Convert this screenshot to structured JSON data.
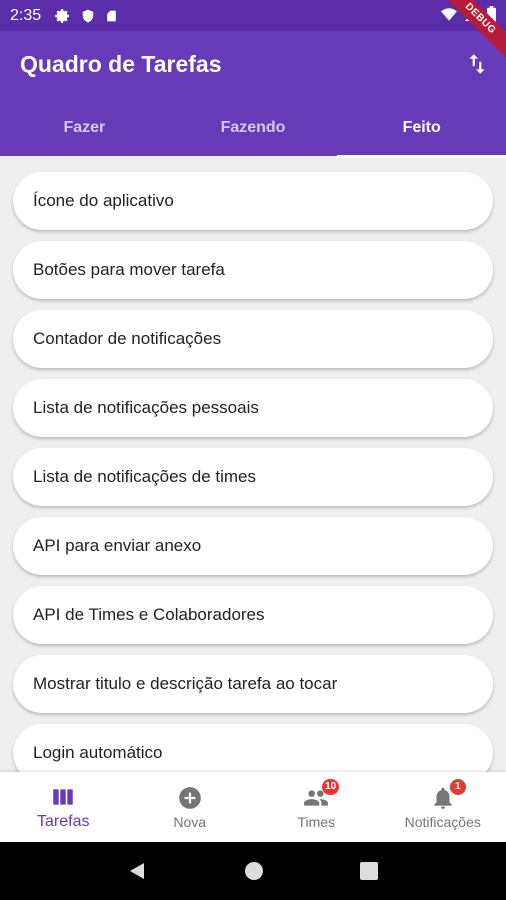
{
  "status_bar": {
    "time": "2:35",
    "icons": [
      "gear-icon",
      "shield-icon",
      "sd-card-icon"
    ],
    "right_icons": [
      "wifi-icon",
      "signal-icon",
      "battery-icon"
    ]
  },
  "debug_banner": "DEBUG",
  "app_bar": {
    "title": "Quadro de Tarefas",
    "action_icon": "swap-vert-icon"
  },
  "tabs": [
    {
      "label": "Fazer",
      "active": false
    },
    {
      "label": "Fazendo",
      "active": false
    },
    {
      "label": "Feito",
      "active": true
    }
  ],
  "tasks": [
    "Ícone do aplicativo",
    "Botões para mover tarefa",
    "Contador de notificações",
    "Lista de notificações pessoais",
    "Lista de notificações de times",
    "API para enviar anexo",
    "API de Times e Colaboradores",
    "Mostrar titulo e descrição tarefa ao tocar",
    "Login automático"
  ],
  "bottom_nav": [
    {
      "label": "Tarefas",
      "icon": "view-column-icon",
      "active": true,
      "badge": null
    },
    {
      "label": "Nova",
      "icon": "add-circle-icon",
      "active": false,
      "badge": null
    },
    {
      "label": "Times",
      "icon": "people-icon",
      "active": false,
      "badge": "10"
    },
    {
      "label": "Notificações",
      "icon": "bell-icon",
      "active": false,
      "badge": "1"
    }
  ],
  "colors": {
    "primary": "#673ab7",
    "status_bar": "#5b2da8",
    "badge": "#e53935",
    "background": "#efefef"
  }
}
